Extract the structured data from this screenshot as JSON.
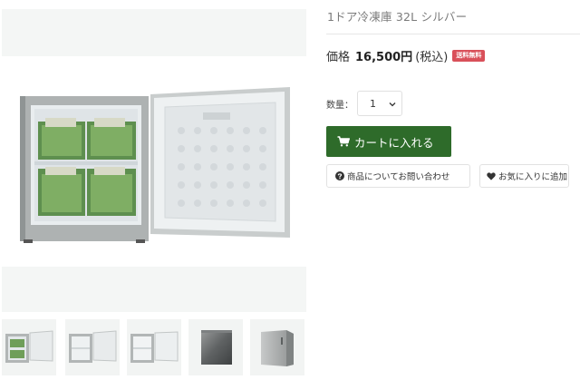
{
  "product": {
    "title": "1ドア冷凍庫 32L シルバー",
    "price_label": "価格",
    "price_value": "16,500円",
    "tax_label": "(税込)",
    "badge": "送料無料"
  },
  "quantity": {
    "label": "数量：",
    "selected": "1"
  },
  "buttons": {
    "cart": "カートに入れる",
    "inquiry": "商品についてお問い合わせ",
    "favorite": "お気に入りに追加"
  },
  "colors": {
    "accent_green": "#2e6b2a",
    "badge_red": "#d9505a",
    "product_silver": "#b9bcbc",
    "placeholder_gray": "#f4f6f5"
  },
  "icons": {
    "cart": "cart-icon",
    "question": "question-circle-icon",
    "heart": "heart-icon",
    "chevron": "chevron-down-icon"
  },
  "gallery": {
    "thumbnails": [
      {
        "view": "open-with-food"
      },
      {
        "view": "open-empty"
      },
      {
        "view": "open-empty-front"
      },
      {
        "view": "closed-dark"
      },
      {
        "view": "closed-angle"
      }
    ]
  }
}
